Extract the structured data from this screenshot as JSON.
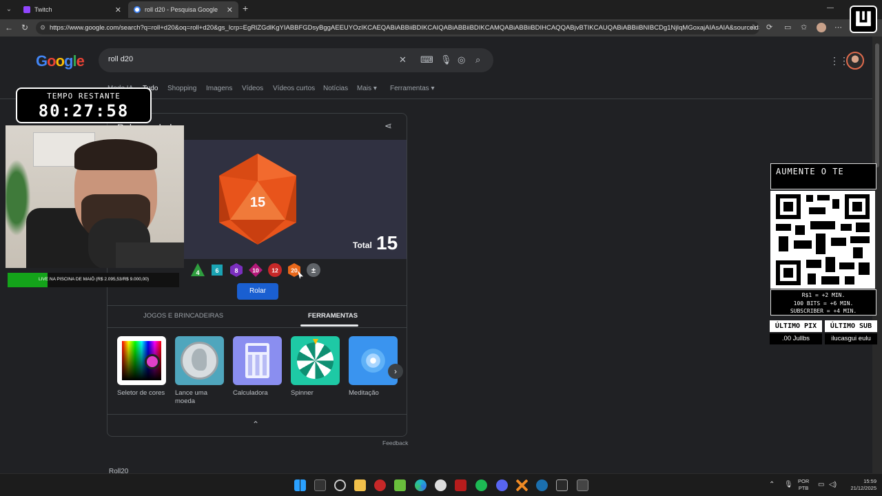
{
  "browser": {
    "tabs": [
      {
        "title": "Twitch",
        "favicon_color": "#9146ff"
      },
      {
        "title": "roll d20 - Pesquisa Google",
        "favicon_color": "#4285f4"
      }
    ],
    "url": "https://www.google.com/search?q=roll+d20&oq=roll+d20&gs_lcrp=EgRlZGdlKgYIABBFGDsyBggAEEUYOzIKCAEQABiABBiiBDIKCAIQABiABBiiBDIKCAMQABiABBiiBDIHCAQQABjvBTIKCAUQABiABBiiBNIBCDg1NjIqMGoxajAIAsAIA&sourceid=chrom..."
  },
  "google": {
    "logo": "Google",
    "query": "roll d20",
    "tabs": [
      "Modo IA",
      "Tudo",
      "Shopping",
      "Imagens",
      "Vídeos",
      "Vídeos curtos",
      "Notícias",
      "Mais",
      "Ferramentas"
    ],
    "card_title": "Rolar os dados",
    "dice_result": "15",
    "total_label": "Total",
    "total_value": "15",
    "dice": [
      {
        "label": "4",
        "color": "#2e9d3e"
      },
      {
        "label": "6",
        "color": "#1aa3b3"
      },
      {
        "label": "8",
        "color": "#7b2fbf"
      },
      {
        "label": "10",
        "color": "#b5197a"
      },
      {
        "label": "12",
        "color": "#c62828"
      },
      {
        "label": "20",
        "color": "#e8681b"
      },
      {
        "label": "±",
        "color": "#5f6368"
      }
    ],
    "roll_button": "Rolar",
    "section_tabs": [
      "JOGOS E BRINCADEIRAS",
      "FERRAMENTAS"
    ],
    "tools": [
      {
        "name": "Seletor de cores"
      },
      {
        "name": "Lance uma moeda"
      },
      {
        "name": "Calculadora"
      },
      {
        "name": "Spinner"
      },
      {
        "name": "Meditação"
      }
    ],
    "feedback": "Feedback",
    "next_result": "Roll20"
  },
  "overlay": {
    "timer_label": "TEMPO RESTANTE",
    "timer_value": "80:27:58",
    "goal_text": "LIVE NA PISCINA DE MAIÔ (R$ 2.095,53/R$ 9.000,00)",
    "goal_progress": 0.2328,
    "promo": "AUMENTE O TE",
    "rates": [
      "R$1 = +2 MIN.",
      "100 BITS = +6 MIN.",
      "SUBSCRIBER = +4 MIN."
    ],
    "last_pix_label": "ÚLTIMO PIX",
    "last_pix_value": ".00    Jullbs",
    "last_sub_label": "ÚLTIMO SUB",
    "last_sub_value": "ilucasgui  eulu"
  },
  "taskbar": {
    "lang": [
      "POR",
      "PTB"
    ],
    "time": "15:59",
    "date": "21/12/2025"
  }
}
